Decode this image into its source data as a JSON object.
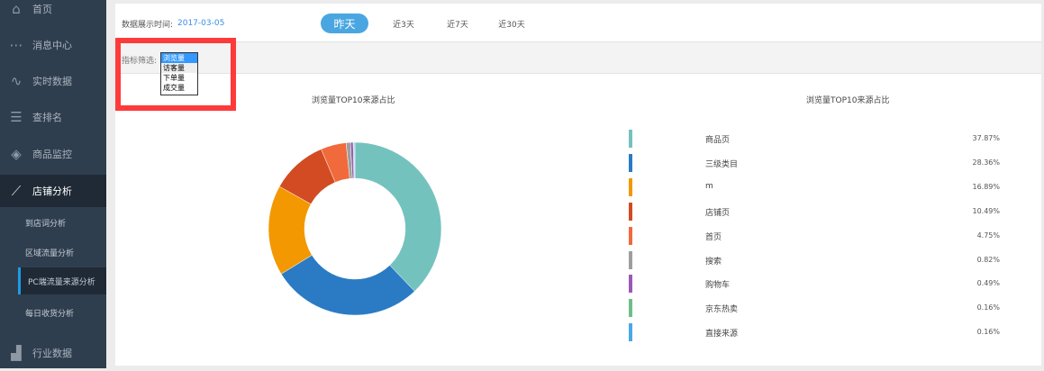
{
  "sidebar": {
    "items": [
      {
        "label": "首页",
        "icon": "home-icon"
      },
      {
        "label": "消息中心",
        "icon": "message-icon"
      },
      {
        "label": "实时数据",
        "icon": "pulse-icon"
      },
      {
        "label": "查排名",
        "icon": "list-icon"
      },
      {
        "label": "商品监控",
        "icon": "layers-icon"
      },
      {
        "label": "店铺分析",
        "icon": "chart-line-icon"
      }
    ],
    "subitems": [
      {
        "label": "到店词分析"
      },
      {
        "label": "区域流量分析"
      },
      {
        "label": "PC端流量来源分析"
      },
      {
        "label": "每日收货分析"
      }
    ],
    "bottom": {
      "label": "行业数据",
      "icon": "bar-chart-icon"
    }
  },
  "topbar": {
    "date_label": "数据展示时间:",
    "date_value": "2017-03-05",
    "tabs": [
      "昨天",
      "近3天",
      "近7天",
      "近30天"
    ],
    "active_tab": "昨天"
  },
  "filter": {
    "label": "指标筛选:",
    "options": [
      "浏览量",
      "访客量",
      "下单量",
      "成交量"
    ],
    "selected": "浏览量"
  },
  "chart_data": {
    "type": "pie",
    "title": "浏览量TOP10来源占比",
    "donut": true,
    "categories": [
      "商品页",
      "三级类目",
      "m",
      "店铺页",
      "首页",
      "搜索",
      "购物车",
      "京东热卖",
      "直接来源"
    ],
    "values": [
      37.87,
      28.36,
      16.89,
      10.49,
      4.75,
      0.82,
      0.49,
      0.16,
      0.16
    ],
    "labels": [
      "37.87%",
      "28.36%",
      "16.89%",
      "10.49%",
      "4.75%",
      "0.82%",
      "0.49%",
      "0.16%",
      "0.16%"
    ],
    "colors": [
      "#74c2be",
      "#2a7bc4",
      "#f39800",
      "#d24b22",
      "#f06a3b",
      "#9e9e9e",
      "#9b59b6",
      "#6dbf87",
      "#4ba8e5"
    ],
    "legend": "right"
  }
}
